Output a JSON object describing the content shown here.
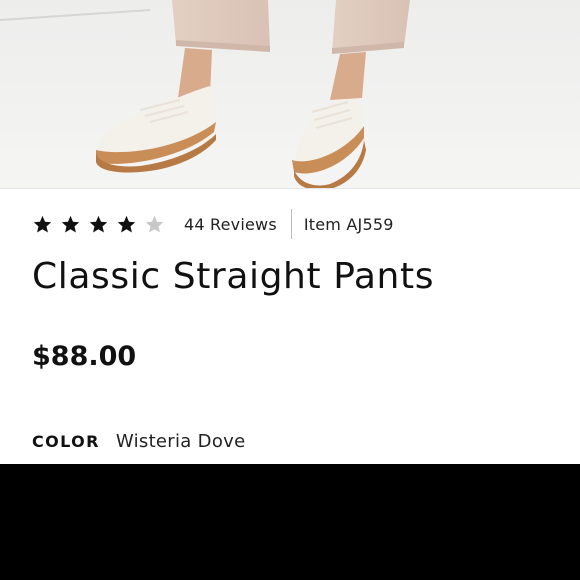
{
  "product": {
    "rating": {
      "value": 4,
      "max": 5
    },
    "reviews_label": "44 Reviews",
    "item_label": "Item AJ559",
    "title": "Classic Straight Pants",
    "price": "$88.00",
    "color_label": "COLOR",
    "color_value": "Wisteria Dove"
  },
  "icons": {
    "star": "star-icon"
  },
  "colors": {
    "star_filled": "#111111",
    "star_empty": "#c8c8c8"
  }
}
